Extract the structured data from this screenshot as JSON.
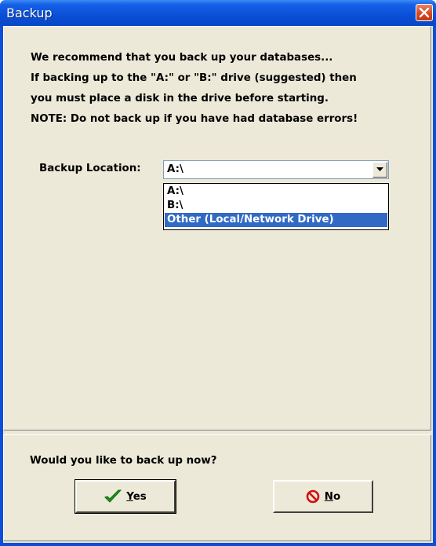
{
  "window": {
    "title": "Backup"
  },
  "message": [
    "We recommend that you back up your databases...",
    "If backing up to the \"A:\" or \"B:\" drive (suggested) then",
    "you must place a disk in the drive before starting.",
    "NOTE: Do not back up if you have had database errors!"
  ],
  "backup_location": {
    "label": "Backup Location:",
    "selected": "A:\\",
    "options": [
      "A:\\",
      "B:\\",
      "Other (Local/Network Drive)"
    ],
    "highlighted_option": "Other (Local/Network Drive)"
  },
  "prompt": "Would you like to back up now?",
  "buttons": {
    "yes": "Yes",
    "no": "No"
  },
  "colors": {
    "titlebar": "#0a4fd6",
    "selection": "#316ac5",
    "face": "#ece9d8",
    "check": "#1a9a1a",
    "no_icon": "#d01010"
  }
}
